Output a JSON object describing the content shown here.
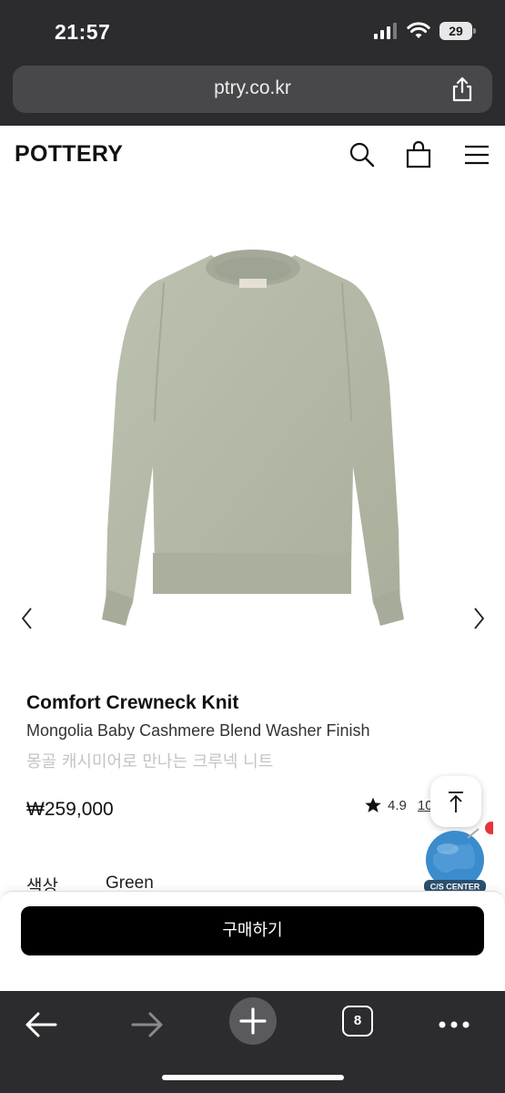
{
  "status_bar": {
    "time": "21:57",
    "battery": "29"
  },
  "browser": {
    "url": "ptry.co.kr",
    "tab_count": "8"
  },
  "site": {
    "logo": "POTTERY"
  },
  "product": {
    "title": "Comfort Crewneck Knit",
    "subtitle": "Mongolia Baby Cashmere Blend Washer Finish",
    "description_kr": "몽골 캐시미어로 만나는 크루넥 니트",
    "price": "₩259,000",
    "rating": "4.9",
    "review_count": "10",
    "option_label": "색상",
    "option_value": "Green"
  },
  "cta": {
    "buy_label": "구매하기"
  },
  "floating": {
    "cs_label": "C/S CENTER"
  },
  "colors": {
    "chrome": "#2c2c2e",
    "buy_button": "#000000",
    "sweater": "#b3b9a6",
    "notification_dot": "#e8323c"
  },
  "icons": [
    "signal-icon",
    "wifi-icon",
    "share-icon",
    "search-icon",
    "bag-icon",
    "menu-icon",
    "prev-arrow-icon",
    "next-arrow-icon",
    "star-icon",
    "arrow-up-icon",
    "back-icon",
    "forward-icon",
    "plus-icon",
    "more-icon"
  ]
}
